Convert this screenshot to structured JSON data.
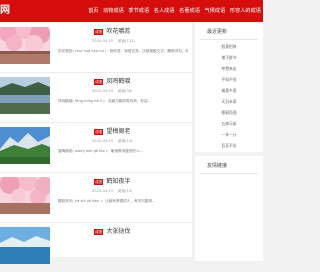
{
  "header": {
    "logo_text": "网",
    "nav": [
      "首页",
      "动物成语",
      "季节成语",
      "名人成语",
      "名著成语",
      "气候成语",
      "形容人的成语"
    ]
  },
  "cards": [
    {
      "tag": "成语",
      "title": "吹花嚼蕊",
      "meta": [
        "2020-04-19",
        "阅读(133)"
      ],
      "desc": "吹花嚼蕊( chuī huā jiáo ruǐ )：指吹弄、嚼咀花蕊。比喻推敲文字，雕琢词句。形容...",
      "thumb": "blossom"
    },
    {
      "tag": "成语",
      "title": "凤鸣鹤唳",
      "meta": [
        "2020-04-19",
        "阅读(30)"
      ],
      "desc": "凤鸣鹤唳( fèng míng hè lì )：凤凰与鹤的鸣叫声。形容...",
      "thumb": "river"
    },
    {
      "tag": "成语",
      "title": "望梅阁老",
      "meta": [
        "2020-04-19",
        "阅读(14)"
      ],
      "desc": "望梅阁老( wàng méi gé lǎo )：喻指等待做官的人...",
      "thumb": "mountain"
    },
    {
      "tag": "成语",
      "title": "鹤知夜半",
      "meta": [
        "2020-04-19",
        "阅读(15)"
      ],
      "desc": "鹤知夜半( hè zhī yè bàn )：比喻有贤德的人，有学识能明...",
      "thumb": "blossom"
    },
    {
      "tag": "成语",
      "title": "大张挞伐",
      "meta": [],
      "desc": "",
      "thumb": "lake"
    }
  ],
  "sidebar": {
    "recommend": {
      "title": "最近更新",
      "items": [
        "假意招徕",
        "诸子群书",
        "夸赞亲友",
        "不知不觉",
        "佛意乡思",
        "天羽未奇",
        "德弱而强",
        "五体兄弟",
        "一年一计",
        "吾吾不出"
      ]
    },
    "links": {
      "title": "友情链接"
    }
  }
}
